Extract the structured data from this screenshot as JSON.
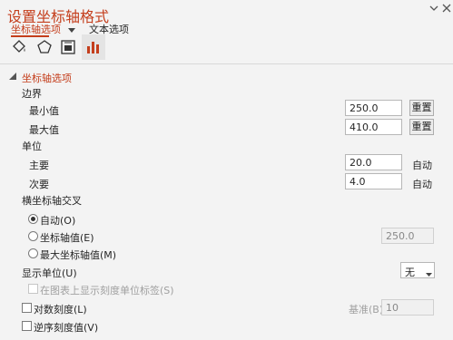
{
  "window": {
    "title": "设置坐标轴格式",
    "dropdown_icon": "chevron-down-icon",
    "close_icon": "close-icon"
  },
  "tabs": [
    {
      "label": "坐标轴选项",
      "active": true
    },
    {
      "label": "文本选项",
      "active": false
    }
  ],
  "category_icons": [
    "fill-line-icon",
    "effects-pentagon-icon",
    "size-properties-icon",
    "axis-options-bar-chart-icon"
  ],
  "section": {
    "title": "坐标轴选项"
  },
  "bounds": {
    "heading": "边界",
    "minimum": {
      "label": "最小值",
      "value": "250.0",
      "reset": "重置"
    },
    "maximum": {
      "label": "最大值",
      "value": "410.0",
      "reset": "重置"
    }
  },
  "units": {
    "heading": "单位",
    "major": {
      "label": "主要",
      "value": "20.0",
      "status": "自动"
    },
    "minor": {
      "label": "次要",
      "value": "4.0",
      "status": "自动"
    }
  },
  "cross": {
    "heading": "横坐标轴交叉",
    "auto": "自动(O)",
    "axis_value": "坐标轴值(E)",
    "axis_value_input": "250.0",
    "max_value": "最大坐标轴值(M)"
  },
  "display_units": {
    "label": "显示单位(U)",
    "value": "无"
  },
  "show_label_on_chart": "在图表上显示刻度单位标签(S)",
  "log_scale": {
    "label": "对数刻度(L)",
    "base_label": "基准(B)",
    "base_value": "10"
  },
  "reverse_order": "逆序刻度值(V)",
  "colors": {
    "accent": "#c43e1c",
    "panel": "#f3f3f3"
  }
}
